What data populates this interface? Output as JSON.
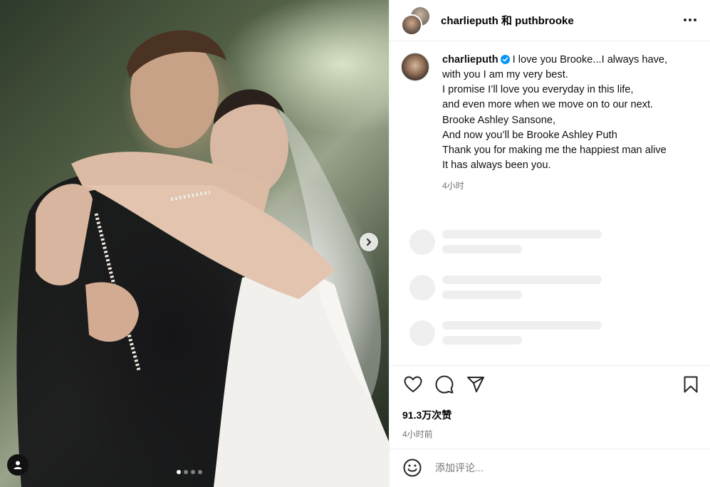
{
  "header": {
    "title": "charlieputh 和 puthbrooke",
    "more_icon": "more-horizontal-icon"
  },
  "caption": {
    "username": "charlieputh",
    "verified_color": "#0095f6",
    "lines": [
      "I love you Brooke...I always have,",
      "with you I am my very best.",
      "I promise I’ll love you everyday in this life,",
      "and even more when we move on to our next.",
      "Brooke Ashley Sansone,",
      "And now you’ll be Brooke Ashley Puth",
      "Thank you for making me the happiest man alive",
      "It has always been you."
    ],
    "time": "4小时"
  },
  "carousel": {
    "slide_count": 4,
    "active_index": 0
  },
  "actions": {
    "like_icon": "heart-icon",
    "comment_icon": "comment-icon",
    "share_icon": "share-icon",
    "save_icon": "bookmark-icon"
  },
  "likes": "91.3万次赞",
  "post_time": "4小时前",
  "comment": {
    "placeholder": "添加评论..."
  }
}
